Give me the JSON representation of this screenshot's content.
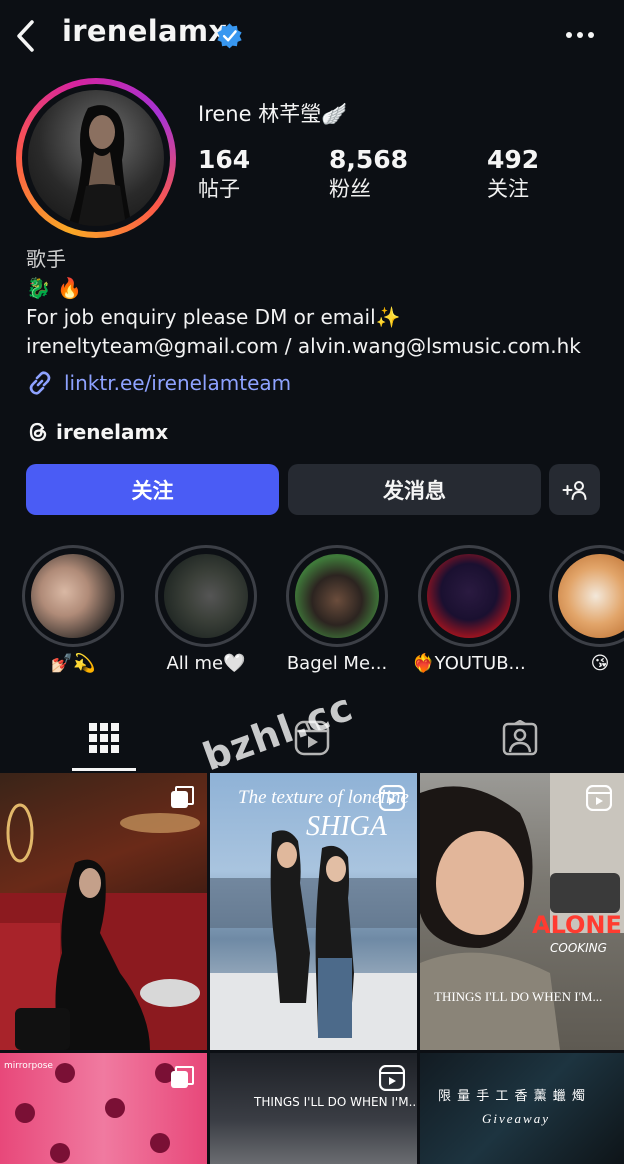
{
  "header": {
    "username": "irenelamx",
    "verified_color": "#3897f0"
  },
  "profile": {
    "display_name": "Irene 林芊瑩🪽",
    "stats": [
      {
        "value": "164",
        "label": "帖子"
      },
      {
        "value": "8,568",
        "label": "粉丝"
      },
      {
        "value": "492",
        "label": "关注"
      }
    ]
  },
  "bio": {
    "category": "歌手",
    "emoji_line": "🐉 🔥",
    "line1": "For job enquiry please DM or email✨",
    "line2": "ireneltyteam@gmail.com / alvin.wang@lsmusic.com.hk",
    "link": "linktr.ee/irenelamteam",
    "threads_handle": "irenelamx"
  },
  "actions": {
    "follow_label": "关注",
    "message_label": "发消息"
  },
  "highlights": [
    {
      "label": "💅🏻💫"
    },
    {
      "label": "All me🤍"
    },
    {
      "label": "Bagel Me..."
    },
    {
      "label": "❤️‍🔥YOUTUB..."
    },
    {
      "label": "😘"
    }
  ],
  "posts": [
    {
      "caption": ""
    },
    {
      "caption_a": "The texture of loneline",
      "caption_b": "SHIGA"
    },
    {
      "caption_a": "ALONE",
      "caption_b": "COOKING",
      "caption_c": "THINGS I'LL DO WHEN I'M..."
    },
    {
      "caption": "mirrorpose"
    },
    {
      "caption": "THINGS I'LL DO WHEN I'M..."
    },
    {
      "caption_a": "限 量 手 工 香 薰 蠟 燭",
      "caption_b": "Giveaway"
    }
  ],
  "watermark": "bzhl.cc",
  "colors": {
    "background": "#0c0f14",
    "accent": "#4a5cf5",
    "link": "#8ea2ff",
    "secondary_button": "#262a32"
  }
}
